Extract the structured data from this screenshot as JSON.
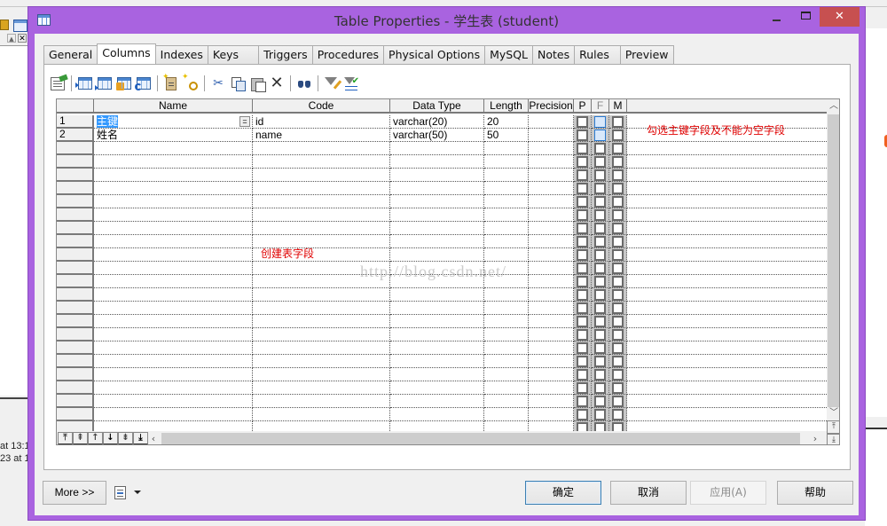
{
  "background_app": {
    "log_lines": [
      "at 13:1",
      "23 at 1"
    ]
  },
  "dialog": {
    "title": "Table Properties - 学生表 (student)",
    "window_buttons": {
      "minimize": "minimize",
      "maximize": "maximize",
      "close": "✕"
    },
    "accent_color": "#a963e0",
    "close_color": "#c75050"
  },
  "tabs": [
    {
      "label": "General",
      "active": false
    },
    {
      "label": "Columns",
      "active": true
    },
    {
      "label": "Indexes",
      "active": false
    },
    {
      "label": "Keys",
      "active": false
    },
    {
      "label": "Triggers",
      "active": false
    },
    {
      "label": "Procedures",
      "active": false
    },
    {
      "label": "Physical Options",
      "active": false
    },
    {
      "label": "MySQL",
      "active": false
    },
    {
      "label": "Notes",
      "active": false
    },
    {
      "label": "Rules",
      "active": false
    },
    {
      "label": "Preview",
      "active": false
    }
  ],
  "toolbar": {
    "buttons": [
      "properties-icon",
      "insert-row-icon",
      "add-row-icon",
      "add-columns-icon",
      "reuse-columns-icon",
      "new-column-icon",
      "new-key-icon",
      "cut-icon",
      "copy-icon",
      "paste-icon",
      "delete-icon",
      "find-icon",
      "filter-edit-icon",
      "filter-apply-icon"
    ]
  },
  "grid": {
    "columns": [
      "Name",
      "Code",
      "Data Type",
      "Length",
      "Precision",
      "P",
      "F",
      "M"
    ],
    "rows": [
      {
        "num": "1",
        "name": "主键",
        "code": "id",
        "data_type": "varchar(20)",
        "length": "20",
        "precision": "",
        "p": false,
        "f": false,
        "m": false
      },
      {
        "num": "2",
        "name": "姓名",
        "code": "name",
        "data_type": "varchar(50)",
        "length": "50",
        "precision": "",
        "p": false,
        "f": false,
        "m": false
      }
    ],
    "ellipsis_label": "=",
    "annotation_columns": "创建表字段",
    "annotation_keys": "勾选主键字段及不能为空字段",
    "watermark": "http://blog.csdn.net/"
  },
  "grid_nav": {
    "buttons": [
      "⤒",
      "⇞",
      "↑",
      "↓",
      "⇟",
      "⤓"
    ]
  },
  "scroll": {
    "up": "︿",
    "down": "﹀",
    "left": "‹",
    "right": "›",
    "top": "⤒",
    "bottom": "⤓"
  },
  "footer": {
    "more": "More >>",
    "ok": "确定",
    "cancel": "取消",
    "apply": "应用(A)",
    "help": "帮助"
  }
}
